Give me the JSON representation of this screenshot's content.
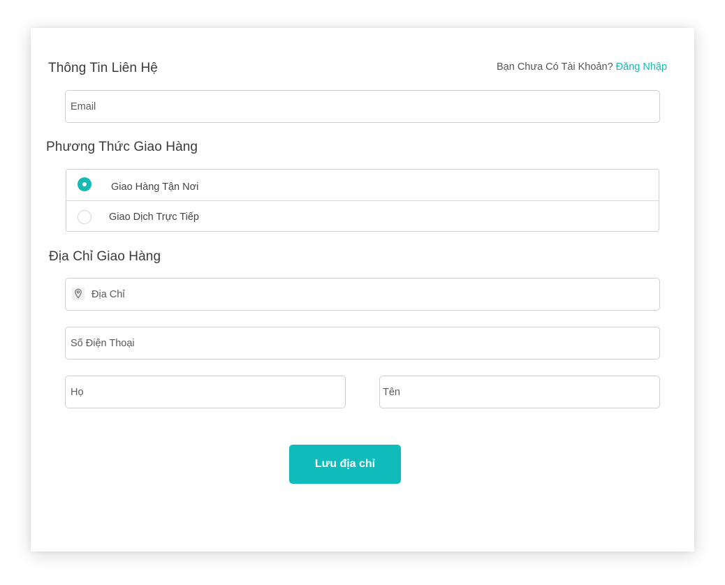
{
  "contact": {
    "heading": "Thông Tin Liên Hệ",
    "login_prompt": "Bạn Chưa Có Tài Khoản?",
    "login_link": "Đăng Nhập",
    "email_placeholder": "Email"
  },
  "shipping": {
    "heading": "Phương Thức Giao Hàng",
    "options": [
      {
        "label": "Giao Hàng Tận Nơi",
        "selected": true
      },
      {
        "label": "Giao Dịch Trực Tiếp",
        "selected": false
      }
    ]
  },
  "address": {
    "heading": "Địa Chỉ Giao Hàng",
    "address_placeholder": "Địa Chỉ",
    "address_icon": "map-pin-icon",
    "phone_placeholder": "Số Điện Thoại",
    "last_name_placeholder": "Họ",
    "first_name_placeholder": "Tên"
  },
  "actions": {
    "save_label": "Lưu địa chỉ"
  },
  "colors": {
    "accent": "#17b9b7",
    "button": "#10bcbb"
  }
}
